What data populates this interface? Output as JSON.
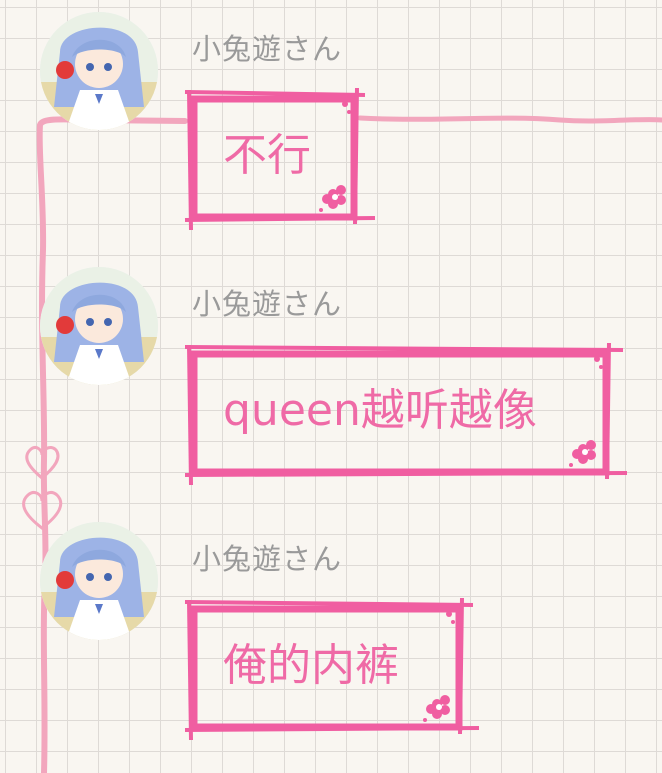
{
  "chat": {
    "messages": [
      {
        "sender": "小兔遊さん",
        "text": "不行"
      },
      {
        "sender": "小兔遊さん",
        "text": "queen越听越像"
      },
      {
        "sender": "小兔遊さん",
        "text": "俺的内裤"
      }
    ]
  },
  "colors": {
    "bubble_border": "#f05ea1",
    "bubble_text": "#ef6aa6",
    "username": "#9a9a9a",
    "deco_line": "#f2a6bd",
    "grid_line": "#dedad6",
    "background": "#f9f6f1"
  },
  "icons": {
    "decoration": [
      "heart-icon",
      "flower-icon"
    ]
  }
}
